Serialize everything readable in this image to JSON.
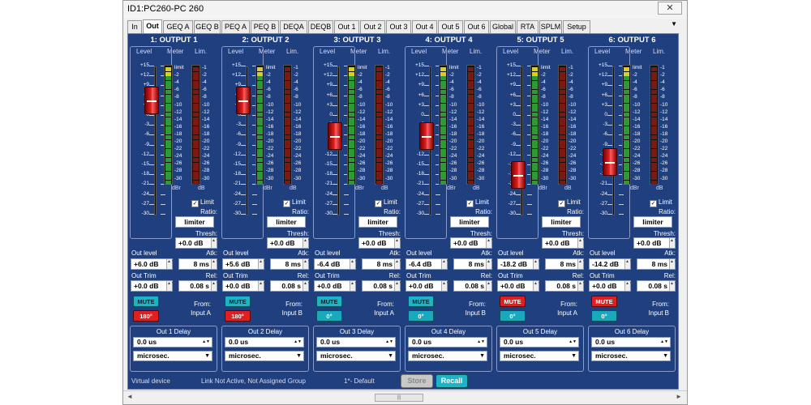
{
  "window": {
    "title": "ID1:PC260-PC 260",
    "close_symbol": "✕"
  },
  "tabs": [
    "In",
    "Out",
    "GEQ A",
    "GEQ B",
    "PEQ A",
    "PEQ B",
    "DEQA",
    "DEQB",
    "Out 1",
    "Out 2",
    "Out 3",
    "Out 4",
    "Out 5",
    "Out 6",
    "Global",
    "RTA",
    "SPLM",
    "Setup"
  ],
  "active_tab": "Out",
  "tab_menu_symbol": "▼",
  "labels": {
    "level": "Level",
    "meter": "Meter",
    "lim": "Lim.",
    "dbr": "dBr",
    "db": "dB",
    "limit": "Limit",
    "ratio": "Ratio:",
    "thresh": "Thresh:",
    "out_level": "Out level",
    "atk": "Atk:",
    "out_trim": "Out Trim",
    "rel": "Rel:",
    "from": "From:"
  },
  "scale_level": [
    "+15",
    "+12",
    "+9",
    "+6",
    "+3",
    "0",
    "-3",
    "-6",
    "-9",
    "-12",
    "-15",
    "-18",
    "-21",
    "-24",
    "-27",
    "-30"
  ],
  "scale_meter": [
    "limit",
    "-2",
    "-4",
    "-6",
    "-8",
    "-10",
    "-12",
    "-14",
    "-16",
    "-18",
    "-20",
    "-22",
    "-24",
    "-26",
    "-28",
    "-30"
  ],
  "scale_lim": [
    "-1",
    "-2",
    "-4",
    "-6",
    "-8",
    "-10",
    "-12",
    "-14",
    "-16",
    "-18",
    "-20",
    "-22",
    "-24",
    "-26",
    "-28",
    "-30"
  ],
  "colors": {
    "panel": "#1f3f7f",
    "meter_green": "#2e9a35",
    "meter_yellow": "#d8d020",
    "lim_red": "#7a1a12",
    "mute_on": "#e02020",
    "mute_off": "#1bb5c7"
  },
  "channels": [
    {
      "title": "1: OUTPUT 1",
      "fader_db": 4.5,
      "limit_checked": true,
      "ratio": "limiter",
      "thresh": "+0.0 dB",
      "out_level": "+6.0 dB",
      "atk": "8 ms",
      "out_trim": "+0.0 dB",
      "rel": "0.08 s",
      "mute_label": "MUTE",
      "mute_active": false,
      "phase_label": "180°",
      "phase_active": true,
      "from": "Input A",
      "delay_title": "Out 1 Delay",
      "delay_value": "0.0 us",
      "delay_unit": "microsec."
    },
    {
      "title": "2: OUTPUT 2",
      "fader_db": 4.5,
      "limit_checked": true,
      "ratio": "limiter",
      "thresh": "+0.0 dB",
      "out_level": "+5.6 dB",
      "atk": "8 ms",
      "out_trim": "+0.0 dB",
      "rel": "0.08 s",
      "mute_label": "MUTE",
      "mute_active": false,
      "phase_label": "180°",
      "phase_active": true,
      "from": "Input B",
      "delay_title": "Out 2 Delay",
      "delay_value": "0.0 us",
      "delay_unit": "microsec."
    },
    {
      "title": "3: OUTPUT 3",
      "fader_db": -6.4,
      "limit_checked": true,
      "ratio": "limiter",
      "thresh": "+0.0 dB",
      "out_level": "-6.4 dB",
      "atk": "8 ms",
      "out_trim": "+0.0 dB",
      "rel": "0.08 s",
      "mute_label": "MUTE",
      "mute_active": false,
      "phase_label": "0°",
      "phase_active": false,
      "from": "Input A",
      "delay_title": "Out 3 Delay",
      "delay_value": "0.0 us",
      "delay_unit": "microsec."
    },
    {
      "title": "4: OUTPUT 4",
      "fader_db": -6.4,
      "limit_checked": true,
      "ratio": "limiter",
      "thresh": "+0.0 dB",
      "out_level": "-6.4 dB",
      "atk": "8 ms",
      "out_trim": "+0.0 dB",
      "rel": "0.08 s",
      "mute_label": "MUTE",
      "mute_active": false,
      "phase_label": "0°",
      "phase_active": false,
      "from": "Input B",
      "delay_title": "Out 4 Delay",
      "delay_value": "0.0 us",
      "delay_unit": "microsec."
    },
    {
      "title": "5: OUTPUT 5",
      "fader_db": -18.2,
      "limit_checked": true,
      "ratio": "limiter",
      "thresh": "+0.0 dB",
      "out_level": "-18.2 dB",
      "atk": "8 ms",
      "out_trim": "+0.0 dB",
      "rel": "0.08 s",
      "mute_label": "MUTE",
      "mute_active": true,
      "phase_label": "0°",
      "phase_active": false,
      "from": "Input A",
      "delay_title": "Out 5 Delay",
      "delay_value": "0.0 us",
      "delay_unit": "microsec."
    },
    {
      "title": "6: OUTPUT 6",
      "fader_db": -14.2,
      "limit_checked": true,
      "ratio": "limiter",
      "thresh": "+0.0 dB",
      "out_level": "-14.2 dB",
      "atk": "8 ms",
      "out_trim": "+0.0 dB",
      "rel": "0.08 s",
      "mute_label": "MUTE",
      "mute_active": true,
      "phase_label": "0°",
      "phase_active": false,
      "from": "Input B",
      "delay_title": "Out 6 Delay",
      "delay_value": "0.0 us",
      "delay_unit": "microsec."
    }
  ],
  "status": {
    "device": "Virtual device",
    "link": "Link Not Active,  Not Assigned Group",
    "preset": "1*- Default",
    "store": "Store",
    "recall": "Recall"
  },
  "scrollbar": {
    "left_arrow": "◄",
    "right_arrow": "►",
    "thumb_grip": "|||"
  }
}
